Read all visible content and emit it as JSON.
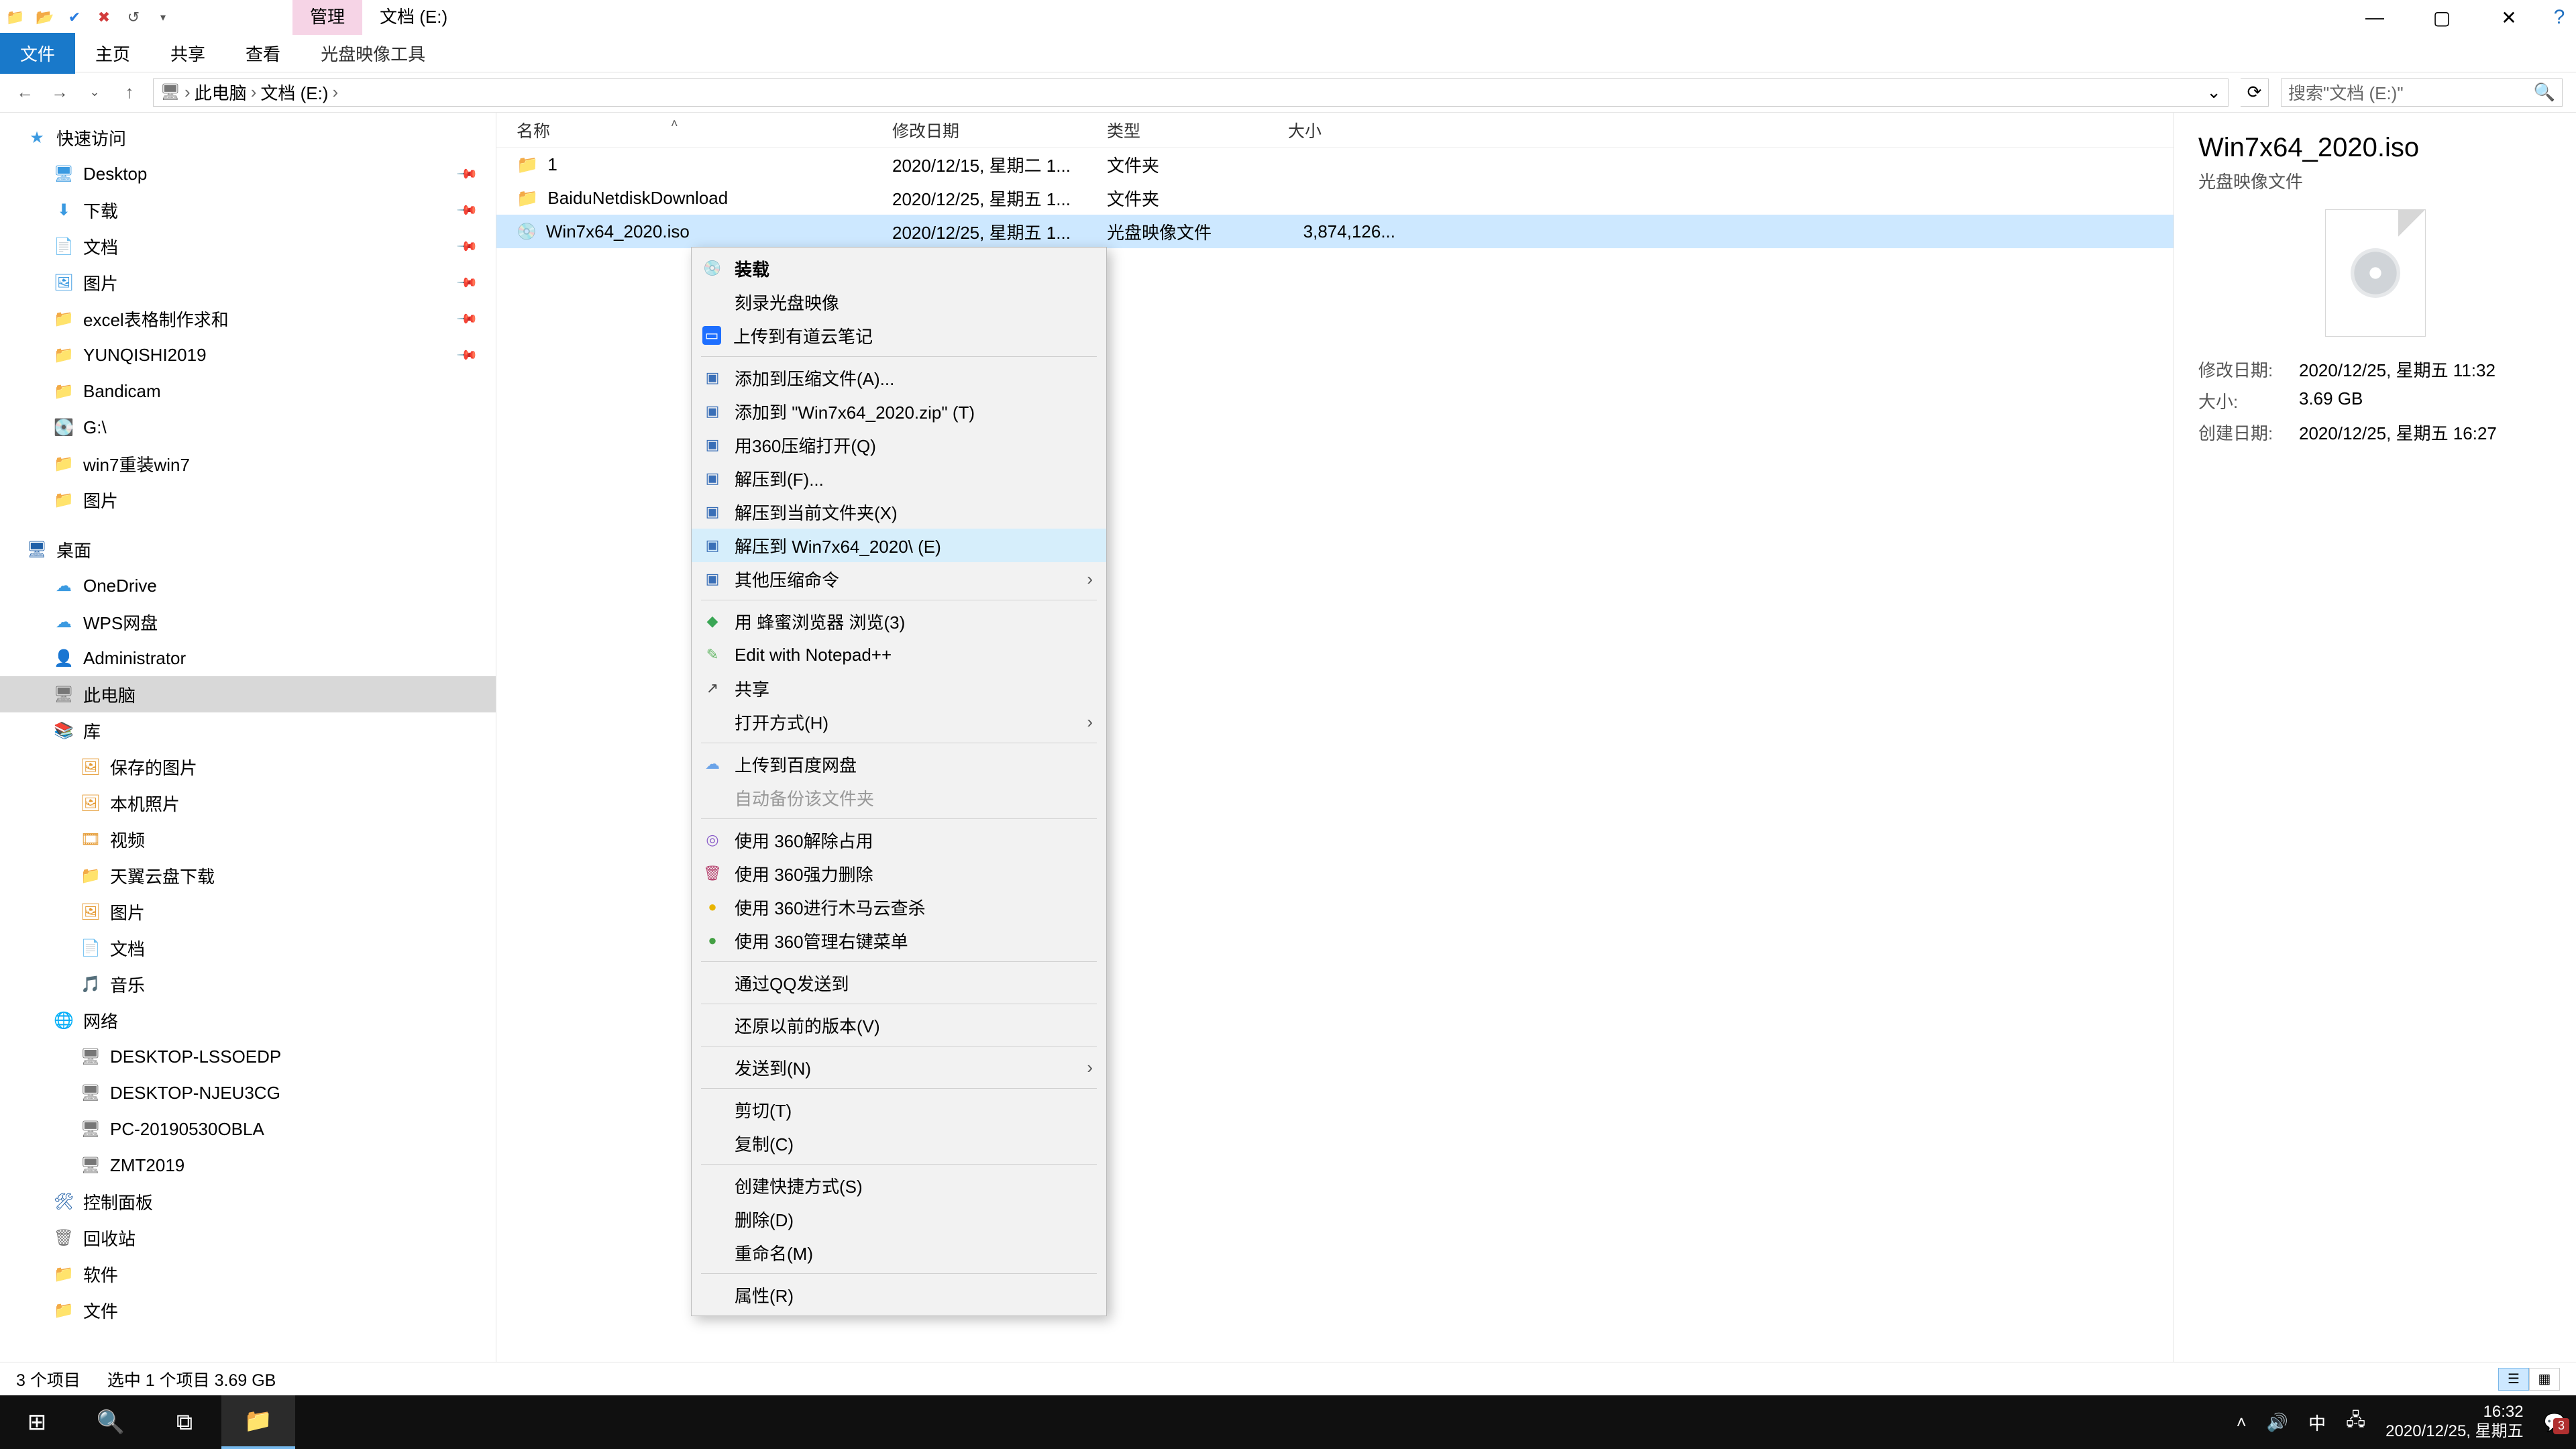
{
  "title_tabs": {
    "manage": "管理",
    "location": "文档 (E:)"
  },
  "window_controls": {
    "min": "—",
    "max": "▢",
    "close": "✕",
    "help": "?"
  },
  "ribbon": {
    "file": "文件",
    "home": "主页",
    "share": "共享",
    "view": "查看",
    "iso_tool": "光盘映像工具"
  },
  "nav": {
    "back": "←",
    "fwd": "→",
    "up": "↑",
    "crumbs": [
      "此电脑",
      "文档 (E:)"
    ],
    "caret": "›",
    "dropdown": "⌄",
    "refresh": "⟳",
    "search_placeholder": "搜索\"文档 (E:)\""
  },
  "tree": {
    "quick": {
      "label": "快速访问"
    },
    "desktop": {
      "label": "Desktop"
    },
    "download": {
      "label": "下载"
    },
    "docs": {
      "label": "文档"
    },
    "pics": {
      "label": "图片"
    },
    "excel": {
      "label": "excel表格制作求和"
    },
    "yunqishi": {
      "label": "YUNQISHI2019"
    },
    "bandicam": {
      "label": "Bandicam"
    },
    "gdrive": {
      "label": "G:\\"
    },
    "win7re": {
      "label": "win7重装win7"
    },
    "pics2": {
      "label": "图片"
    },
    "desk_cn": {
      "label": "桌面"
    },
    "onedrive": {
      "label": "OneDrive"
    },
    "wps": {
      "label": "WPS网盘"
    },
    "admin": {
      "label": "Administrator"
    },
    "thispc": {
      "label": "此电脑"
    },
    "lib": {
      "label": "库"
    },
    "savedpic": {
      "label": "保存的图片"
    },
    "localpic": {
      "label": "本机照片"
    },
    "video": {
      "label": "视频"
    },
    "tianyi": {
      "label": "天翼云盘下载"
    },
    "pic3": {
      "label": "图片"
    },
    "doc2": {
      "label": "文档"
    },
    "music": {
      "label": "音乐"
    },
    "network": {
      "label": "网络"
    },
    "pc1": {
      "label": "DESKTOP-LSSOEDP"
    },
    "pc2": {
      "label": "DESKTOP-NJEU3CG"
    },
    "pc3": {
      "label": "PC-20190530OBLA"
    },
    "pc4": {
      "label": "ZMT2019"
    },
    "ctrl": {
      "label": "控制面板"
    },
    "recycle": {
      "label": "回收站"
    },
    "soft": {
      "label": "软件"
    },
    "files": {
      "label": "文件"
    }
  },
  "columns": {
    "name": "名称",
    "date": "修改日期",
    "type": "类型",
    "size": "大小"
  },
  "rows": [
    {
      "name": "1",
      "date": "2020/12/15, 星期二 1...",
      "type": "文件夹",
      "size": ""
    },
    {
      "name": "BaiduNetdiskDownload",
      "date": "2020/12/25, 星期五 1...",
      "type": "文件夹",
      "size": ""
    },
    {
      "name": "Win7x64_2020.iso",
      "date": "2020/12/25, 星期五 1...",
      "type": "光盘映像文件",
      "size": "3,874,126..."
    }
  ],
  "ctx": {
    "mount": "装载",
    "burn": "刻录光盘映像",
    "ydnote": "上传到有道云笔记",
    "addarc": "添加到压缩文件(A)...",
    "addzip": "添加到 \"Win7x64_2020.zip\" (T)",
    "openwith360": "用360压缩打开(Q)",
    "extractto": "解压到(F)...",
    "extracthere": "解压到当前文件夹(X)",
    "extractnamed": "解压到 Win7x64_2020\\ (E)",
    "otherzip": "其他压缩命令",
    "beebrowse": "用 蜂蜜浏览器 浏览(3)",
    "npp": "Edit with Notepad++",
    "share": "共享",
    "openwith": "打开方式(H)",
    "baidu": "上传到百度网盘",
    "autobak": "自动备份该文件夹",
    "u360a": "使用 360解除占用",
    "u360b": "使用 360强力删除",
    "u360c": "使用 360进行木马云查杀",
    "u360d": "使用 360管理右键菜单",
    "qqsend": "通过QQ发送到",
    "restore": "还原以前的版本(V)",
    "sendto": "发送到(N)",
    "cut": "剪切(T)",
    "copy": "复制(C)",
    "shortcut": "创建快捷方式(S)",
    "delete": "删除(D)",
    "rename": "重命名(M)",
    "props": "属性(R)"
  },
  "details": {
    "title": "Win7x64_2020.iso",
    "subtype": "光盘映像文件",
    "mdate_k": "修改日期:",
    "mdate_v": "2020/12/25, 星期五 11:32",
    "size_k": "大小:",
    "size_v": "3.69 GB",
    "cdate_k": "创建日期:",
    "cdate_v": "2020/12/25, 星期五 16:27"
  },
  "status": {
    "count": "3 个项目",
    "sel": "选中 1 个项目  3.69 GB"
  },
  "taskbar": {
    "ime": "中",
    "time": "16:32",
    "date": "2020/12/25, 星期五"
  }
}
